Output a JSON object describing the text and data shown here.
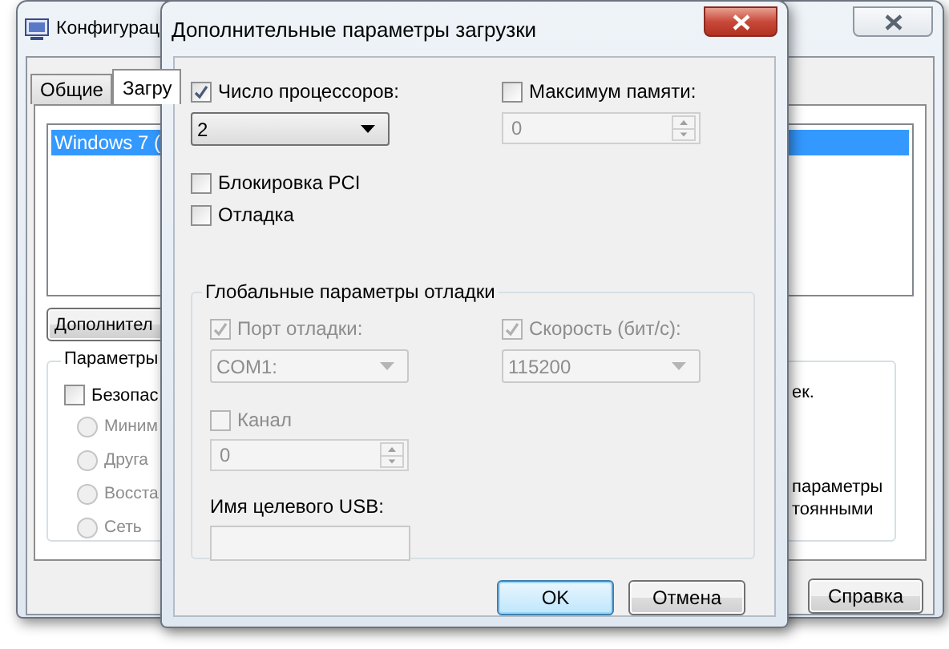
{
  "background_window": {
    "title": "Конфигурац",
    "tabs": [
      {
        "label": "Общие",
        "selected": false
      },
      {
        "label": "Загру",
        "selected": true
      }
    ],
    "boot_list": [
      {
        "label": "Windows 7 (",
        "selected": true
      }
    ],
    "advanced_button": "Дополнител",
    "boot_options": {
      "title": "Параметры",
      "safe_boot": {
        "label": "Безопас",
        "checked": false
      },
      "radios": [
        {
          "label": "Миним",
          "selected": false,
          "disabled": true
        },
        {
          "label": "Друга",
          "selected": false,
          "disabled": true
        },
        {
          "label": "Восста",
          "selected": false,
          "disabled": true
        },
        {
          "label": "Сеть",
          "selected": false,
          "disabled": true
        }
      ]
    },
    "right_texts": [
      "ек.",
      "параметры",
      "тоянными"
    ],
    "help_button": "Справка"
  },
  "dialog": {
    "title": "Дополнительные параметры загрузки",
    "processors": {
      "label": "Число процессоров:",
      "checked": true,
      "value": "2"
    },
    "max_memory": {
      "label": "Максимум памяти:",
      "checked": false,
      "value": "0"
    },
    "pci_lock": {
      "label": "Блокировка PCI",
      "checked": false
    },
    "debug": {
      "label": "Отладка",
      "checked": false
    },
    "debug_group": {
      "title": "Глобальные параметры отладки",
      "port": {
        "label": "Порт отладки:",
        "checked": true,
        "disabled": true,
        "value": "COM1:"
      },
      "baud": {
        "label": "Скорость (бит/с):",
        "checked": true,
        "disabled": true,
        "value": "115200"
      },
      "channel": {
        "label": "Канал",
        "checked": false,
        "disabled": true,
        "value": "0"
      },
      "usb": {
        "label": "Имя целевого USB:"
      }
    },
    "buttons": [
      {
        "label": "OK",
        "default": true
      },
      {
        "label": "Отмена",
        "default": false
      }
    ]
  }
}
